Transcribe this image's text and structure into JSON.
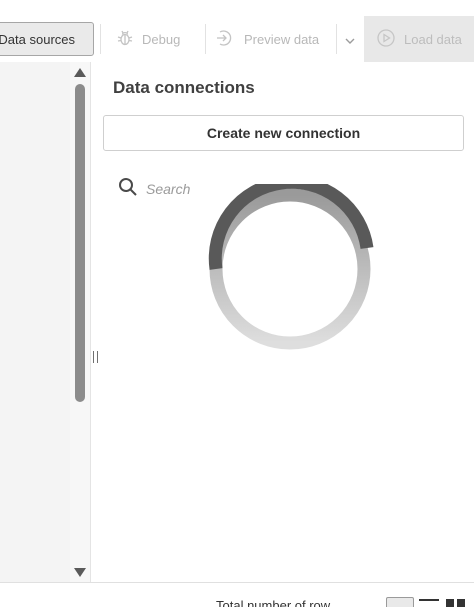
{
  "toolbar": {
    "data_sources_label": "Data sources",
    "debug_label": "Debug",
    "preview_label": "Preview data",
    "load_label": "Load data"
  },
  "icons": {
    "debug": "bug-icon",
    "preview": "preview-icon",
    "dropdown": "chevron-down-icon",
    "load": "play-circle-icon",
    "search": "search-icon",
    "scroll_up": "arrow-up-icon",
    "scroll_down": "arrow-down-icon",
    "view_grid": "grid-view-icon",
    "view_list": "list-view-icon",
    "view_split": "split-view-icon"
  },
  "panel": {
    "title": "Data connections",
    "create_label": "Create new connection",
    "search_placeholder": "Search"
  },
  "footer": {
    "text": "Total number of row"
  },
  "colors": {
    "spinner_active": "#595959",
    "spinner_track": "#d9d9d9",
    "toolbar_disabled": "#b8b8b8",
    "load_bg": "#e8e8e8"
  }
}
